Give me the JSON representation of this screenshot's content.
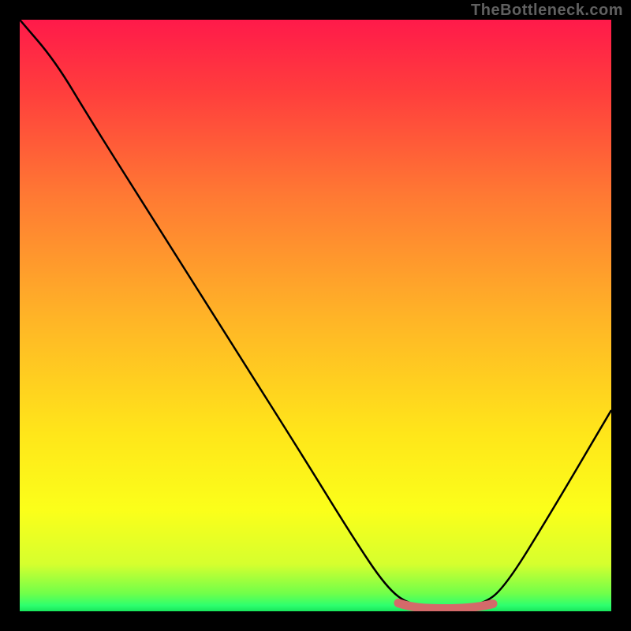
{
  "watermark": "TheBottleneck.com",
  "colors": {
    "background": "#000000",
    "curve": "#000000",
    "thick_segment": "#d46a6a",
    "gradient_stops": [
      {
        "offset": "0%",
        "color": "#ff1a4a"
      },
      {
        "offset": "12%",
        "color": "#ff3d3d"
      },
      {
        "offset": "30%",
        "color": "#ff7a33"
      },
      {
        "offset": "50%",
        "color": "#ffb327"
      },
      {
        "offset": "70%",
        "color": "#ffe61a"
      },
      {
        "offset": "83%",
        "color": "#fbff1a"
      },
      {
        "offset": "92%",
        "color": "#d6ff2e"
      },
      {
        "offset": "97%",
        "color": "#70ff4a"
      },
      {
        "offset": "99%",
        "color": "#2eff6e"
      },
      {
        "offset": "100%",
        "color": "#18e65c"
      }
    ]
  },
  "chart_data": {
    "type": "line",
    "title": "",
    "xlabel": "",
    "ylabel": "",
    "xlim": [
      0,
      100
    ],
    "ylim": [
      0,
      100
    ],
    "series": [
      {
        "name": "bottleneck-curve",
        "points": [
          {
            "x": 0,
            "y": 100
          },
          {
            "x": 6,
            "y": 93
          },
          {
            "x": 12,
            "y": 83
          },
          {
            "x": 24,
            "y": 64
          },
          {
            "x": 36,
            "y": 45
          },
          {
            "x": 48,
            "y": 26
          },
          {
            "x": 56,
            "y": 13
          },
          {
            "x": 62,
            "y": 4
          },
          {
            "x": 66,
            "y": 1
          },
          {
            "x": 72,
            "y": 0.5
          },
          {
            "x": 78,
            "y": 1
          },
          {
            "x": 82,
            "y": 4
          },
          {
            "x": 90,
            "y": 17
          },
          {
            "x": 100,
            "y": 34
          }
        ]
      }
    ],
    "highlight_segment": {
      "name": "optimal-range",
      "x_start": 64,
      "x_end": 80,
      "y_approx": 1
    }
  }
}
